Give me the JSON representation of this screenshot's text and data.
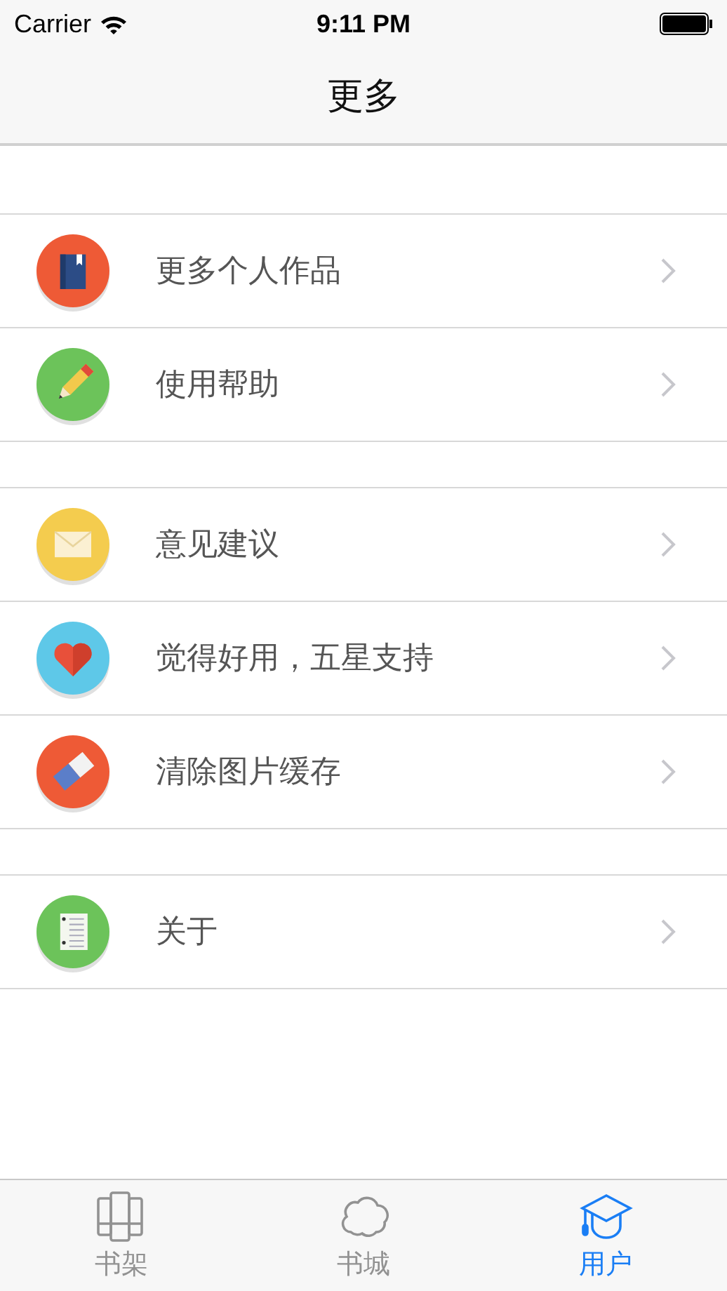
{
  "status_bar": {
    "carrier": "Carrier",
    "time": "9:11 PM"
  },
  "nav": {
    "title": "更多"
  },
  "groups": [
    {
      "items": [
        {
          "label": "更多个人作品",
          "kind": "book",
          "color": "#ee5a36"
        },
        {
          "label": "使用帮助",
          "kind": "pencil",
          "color": "#6cc35a"
        }
      ]
    },
    {
      "items": [
        {
          "label": "意见建议",
          "kind": "mail",
          "color": "#f4cc4e"
        },
        {
          "label": "觉得好用，五星支持",
          "kind": "heart",
          "color": "#5ec8e8"
        },
        {
          "label": "清除图片缓存",
          "kind": "eraser",
          "color": "#ee5a36"
        }
      ]
    },
    {
      "items": [
        {
          "label": "关于",
          "kind": "notes",
          "color": "#6cc35a"
        }
      ]
    }
  ],
  "tabs": [
    {
      "label": "书架",
      "kind": "shelf",
      "selected": false
    },
    {
      "label": "书城",
      "kind": "cloud",
      "selected": false
    },
    {
      "label": "用户",
      "kind": "cap",
      "selected": true
    }
  ]
}
